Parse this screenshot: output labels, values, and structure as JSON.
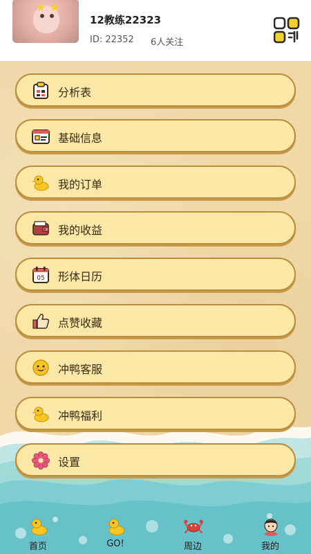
{
  "profile": {
    "username": "12教练22323",
    "id_text": "ID: 22352",
    "followers_text": "6人关注"
  },
  "menu": [
    {
      "label": "分析表",
      "icon": "clipboard-icon"
    },
    {
      "label": "基础信息",
      "icon": "id-card-icon"
    },
    {
      "label": "我的订单",
      "icon": "duck-icon"
    },
    {
      "label": "我的收益",
      "icon": "wallet-icon"
    },
    {
      "label": "形体日历",
      "icon": "calendar-icon"
    },
    {
      "label": "点赞收藏",
      "icon": "thumbs-up-icon"
    },
    {
      "label": "冲鸭客服",
      "icon": "smiley-face-icon"
    },
    {
      "label": "冲鸭福利",
      "icon": "duck-icon"
    },
    {
      "label": "设置",
      "icon": "flower-gear-icon"
    }
  ],
  "tabs": [
    {
      "label": "首页",
      "icon": "duck-icon"
    },
    {
      "label": "GO!",
      "icon": "duck-icon"
    },
    {
      "label": "周边",
      "icon": "crab-icon"
    },
    {
      "label": "我的",
      "icon": "avatar-icon"
    }
  ],
  "calendar_day": "05",
  "colors": {
    "button_fill": "#fbe8a6",
    "button_border": "#b88d3c",
    "sand": "#f0d8a8",
    "sea": "#7ecdd0"
  }
}
